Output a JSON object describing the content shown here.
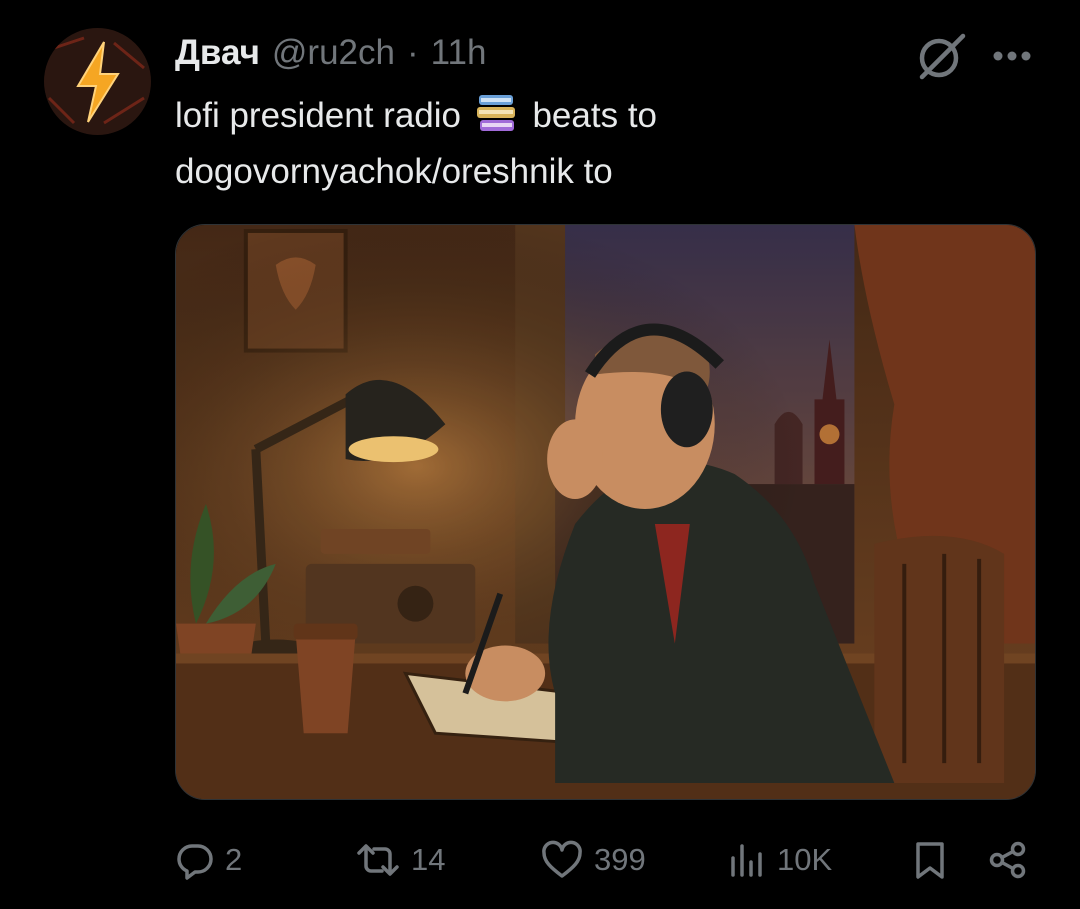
{
  "author": {
    "display_name": "Двач",
    "handle": "@ru2ch",
    "separator": "·",
    "time": "11h",
    "avatar_icon": "lightning-bolt-icon"
  },
  "tweet": {
    "text_part1": "lofi president radio",
    "emoji": "books-emoji",
    "text_part2": "beats to",
    "text_line2": "dogovornyachok/oreshnik to"
  },
  "media": {
    "description": "photo-attachment"
  },
  "actions": {
    "replies": "2",
    "retweets": "14",
    "likes": "399",
    "views": "10K"
  },
  "colors": {
    "background": "#000000",
    "text": "#e7e9ea",
    "secondary": "#71767b",
    "accent_orange": "#f5a623"
  }
}
